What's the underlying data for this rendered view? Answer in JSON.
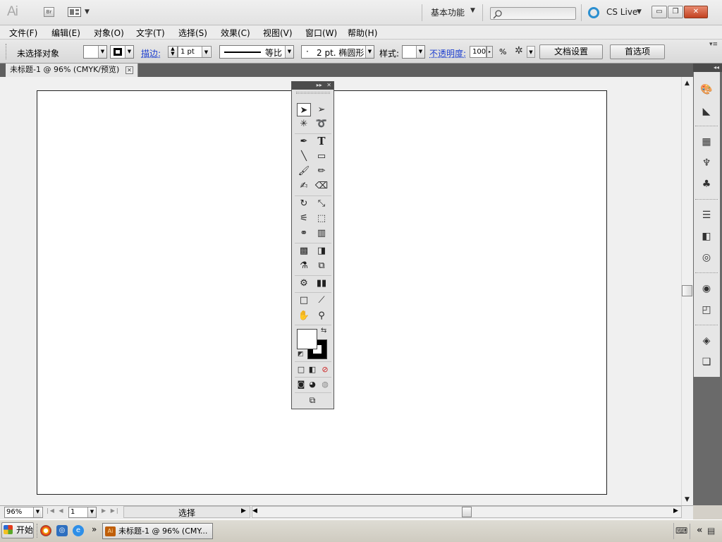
{
  "app": {
    "logo": "Ai",
    "bridge_button": "Br",
    "workspace": "基本功能",
    "search_placeholder": "",
    "cs_live": "CS Live",
    "window_buttons": {
      "minimize": "▭",
      "restore": "❐",
      "close": "✕"
    }
  },
  "menubar": {
    "items": [
      "文件(F)",
      "编辑(E)",
      "对象(O)",
      "文字(T)",
      "选择(S)",
      "效果(C)",
      "视图(V)",
      "窗口(W)",
      "帮助(H)"
    ]
  },
  "controlbar": {
    "selection_status": "未选择对象",
    "stroke_label": "描边:",
    "stroke_weight": "1 pt",
    "stroke_profile": "等比",
    "brush": "2 pt. 椭圆形",
    "brush_prefix": "·",
    "style_label": "样式:",
    "opacity_label": "不透明度:",
    "opacity_value": "100",
    "opacity_unit": "%",
    "doc_setup_button": "文档设置",
    "preferences_button": "首选项"
  },
  "document": {
    "tab_title": "未标题-1 @ 96% (CMYK/预览)"
  },
  "toolbox": {
    "collapse_label": "▸▸",
    "close_label": "✕"
  },
  "dock": {
    "collapse_label": "◂◂"
  },
  "statusbar": {
    "zoom": "96%",
    "page": "1",
    "status_text": "选择"
  },
  "taskbar": {
    "start": "开始",
    "overflow": "»",
    "task_title": "未标题-1 @ 96% (CMY...",
    "tray_chevron": "«"
  },
  "colors": {
    "accent_link": "#1d3fcf",
    "close_red": "#c24120",
    "ai_orange": "#bf5e0a"
  }
}
